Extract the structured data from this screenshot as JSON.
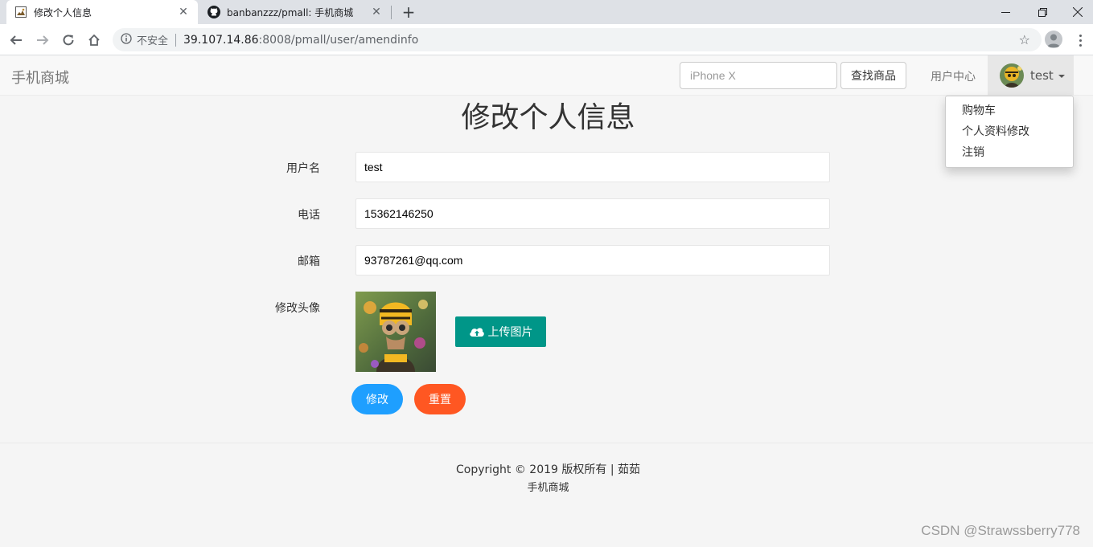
{
  "browser": {
    "tabs": [
      {
        "title": "修改个人信息",
        "close": "✕"
      },
      {
        "title": "banbanzzz/pmall: 手机商城",
        "close": "✕"
      }
    ],
    "new_tab": "+",
    "window_controls": {
      "minimize": "—",
      "restore": "❐",
      "close": "✕"
    },
    "address": {
      "security": "不安全",
      "host": "39.107.14.86",
      "path": ":8008/pmall/user/amendinfo",
      "star": "☆"
    }
  },
  "navbar": {
    "brand": "手机商城",
    "search_placeholder": "iPhone X",
    "search_button": "查找商品",
    "user_center": "用户中心",
    "username": "test"
  },
  "dropdown": {
    "items": [
      "购物车",
      "个人资料修改",
      "注销"
    ]
  },
  "form": {
    "title": "修改个人信息",
    "username_label": "用户名",
    "username_value": "test",
    "phone_label": "电话",
    "phone_value": "15362146250",
    "email_label": "邮箱",
    "email_value": "93787261@qq.com",
    "avatar_label": "修改头像",
    "upload_button": "上传图片",
    "modify_button": "修改",
    "reset_button": "重置"
  },
  "footer": {
    "copyright": "Copyright © 2019 版权所有 | 茹茹",
    "brand": "手机商城"
  },
  "watermark": "CSDN @Strawssberry778",
  "colors": {
    "upload": "#009688",
    "modify": "#1e9fff",
    "reset": "#ff5722",
    "navbar_bg": "#f8f8f8",
    "page_bg": "#f5f5f5"
  }
}
